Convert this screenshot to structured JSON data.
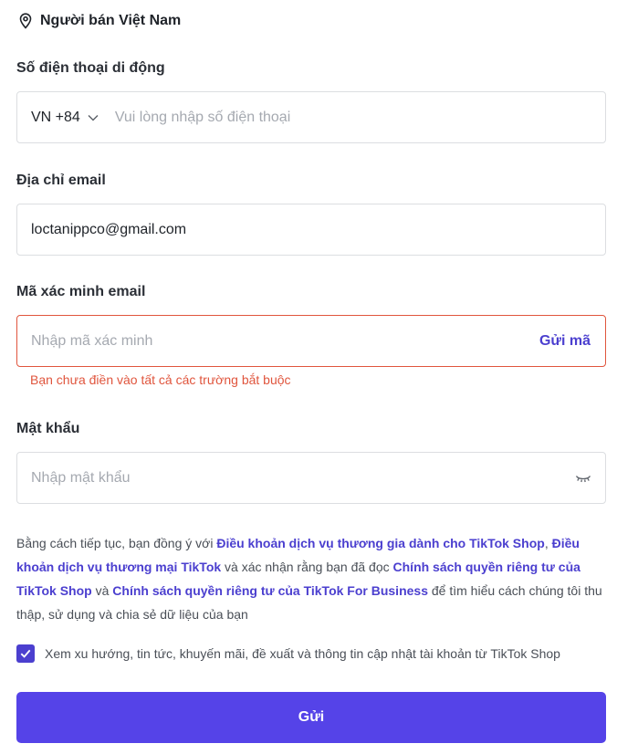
{
  "region": {
    "icon": "location-pin-icon",
    "label": "Người bán Việt Nam"
  },
  "phone": {
    "label": "Số điện thoại di động",
    "country_code": "VN +84",
    "placeholder": "Vui lòng nhập số điện thoại",
    "value": ""
  },
  "email": {
    "label": "Địa chỉ email",
    "value": "loctanippco@gmail.com"
  },
  "verification": {
    "label": "Mã xác minh email",
    "placeholder": "Nhập mã xác minh",
    "send_code_label": "Gửi mã",
    "error_text": "Bạn chưa điền vào tất cả các trường bắt buộc"
  },
  "password": {
    "label": "Mật khẩu",
    "placeholder": "Nhập mật khẩu",
    "toggle_icon": "eye-closed-icon"
  },
  "terms": {
    "part1": "Bằng cách tiếp tục, bạn đồng ý với ",
    "link1": "Điều khoản dịch vụ thương gia dành cho TikTok Shop",
    "sep1": ", ",
    "link2": "Điều khoản dịch vụ thương mại TikTok",
    "part2": " và xác nhận rằng bạn đã đọc ",
    "link3": "Chính sách quyền riêng tư của TikTok Shop",
    "part3": " và ",
    "link4": "Chính sách quyền riêng tư của TikTok For Business",
    "part4": " để tìm hiểu cách chúng tôi thu thập, sử dụng và chia sẻ dữ liệu của bạn"
  },
  "consent": {
    "checked": true,
    "label": "Xem xu hướng, tin tức, khuyến mãi, đề xuất và thông tin cập nhật tài khoản từ TikTok Shop"
  },
  "submit_label": "Gửi",
  "colors": {
    "accent": "#5543e8",
    "link": "#4b3fcf",
    "error": "#e0553d"
  }
}
